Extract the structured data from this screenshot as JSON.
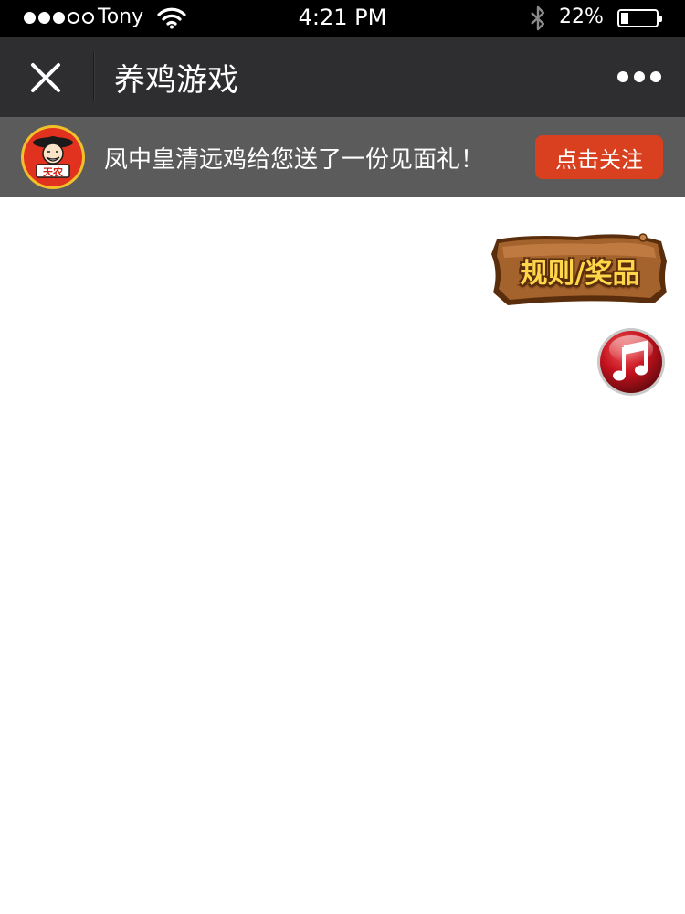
{
  "status_bar": {
    "carrier": "Tony",
    "time": "4:21 PM",
    "battery": "22%",
    "battery_level": 0.22,
    "signal_bars": 3,
    "signal_total": 5
  },
  "nav": {
    "title": "养鸡游戏",
    "close_icon": "close-icon",
    "more_icon": "more-icon"
  },
  "banner": {
    "message": "凤中皇清远鸡给您送了一份见面礼！",
    "follow_label": "点击关注",
    "logo_text": "天农"
  },
  "floating": {
    "rules_label": "规则/奖品",
    "music_icon": "music-note-icon"
  },
  "colors": {
    "status_bar_bg": "#000000",
    "nav_bg": "#2e2e30",
    "banner_bg": "#5b5b5b",
    "follow_button": "#d8401f",
    "logo_ring": "#f2c02a",
    "logo_fill": "#e0321e",
    "sign_wood": "#9a5a28",
    "sign_text": "#ffd54a",
    "music_button": "#c4121e"
  }
}
